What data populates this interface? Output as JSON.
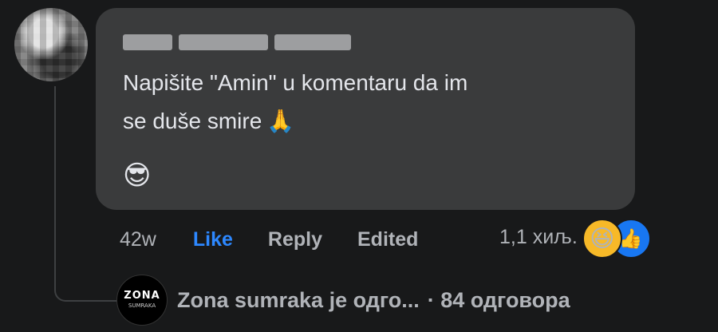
{
  "comment": {
    "author_name": "",
    "text_line1": "Napišite \"Amin\" u komentaru da im",
    "text_line2": "se duše smire",
    "pray_emoji": "🙏",
    "sticker_emoji": "😎"
  },
  "actions": {
    "time": "42w",
    "like": "Like",
    "reply": "Reply",
    "edited": "Edited",
    "reaction_count": "1,1 хиљ.",
    "haha_emoji": "😆",
    "like_icon": "👍"
  },
  "replies": {
    "avatar_line1": "ZONA",
    "avatar_line2": "SUMRAKA",
    "preview": "Zona sumraka je одго...",
    "count": "· 84 одговора"
  },
  "colors": {
    "background": "#18191a",
    "bubble": "#3a3b3c",
    "like_blue": "#2d88ff",
    "muted": "#b0b3b8"
  }
}
